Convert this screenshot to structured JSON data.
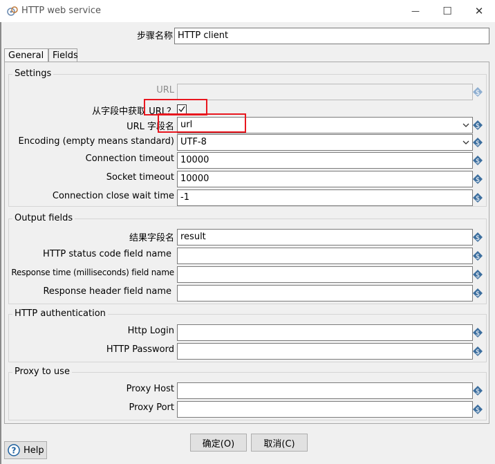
{
  "window": {
    "title": "HTTP web service",
    "minimize_glyph": "—",
    "maximize_glyph": "☐",
    "close_glyph": "✕"
  },
  "step": {
    "label": "步骤名称",
    "value": "HTTP client"
  },
  "tabs": [
    {
      "label": "General",
      "active": true
    },
    {
      "label": "Fields",
      "active": false
    }
  ],
  "settings": {
    "title": "Settings",
    "url": {
      "label": "URL",
      "value": "",
      "enabled": false
    },
    "url_from_field": {
      "label": "从字段中获取 URL？",
      "checked": true
    },
    "url_field_name": {
      "label": "URL 字段名",
      "value": "url"
    },
    "encoding": {
      "label": "Encoding (empty means standard)",
      "value": "UTF-8"
    },
    "connection_timeout": {
      "label": "Connection timeout",
      "value": "10000"
    },
    "socket_timeout": {
      "label": "Socket timeout",
      "value": "10000"
    },
    "close_wait_time": {
      "label": "Connection close wait time",
      "value": "-1"
    }
  },
  "output_fields": {
    "title": "Output fields",
    "result_field": {
      "label": "结果字段名",
      "value": "result"
    },
    "status_code_field": {
      "label": "HTTP status code field name",
      "value": ""
    },
    "response_time_field": {
      "label": "Response time (milliseconds) field name",
      "value": ""
    },
    "response_header_field": {
      "label": "Response header field name",
      "value": ""
    }
  },
  "authentication": {
    "title": "HTTP authentication",
    "login": {
      "label": "Http Login",
      "value": ""
    },
    "password": {
      "label": "HTTP Password",
      "value": ""
    }
  },
  "proxy": {
    "title": "Proxy to use",
    "host": {
      "label": "Proxy Host",
      "value": ""
    },
    "port": {
      "label": "Proxy Port",
      "value": ""
    }
  },
  "buttons": {
    "ok": "确定(O)",
    "cancel": "取消(C)",
    "help": "Help"
  },
  "colors": {
    "highlight_box": "#e8161e",
    "variable_icon": "#3c6e9e"
  },
  "icons": {
    "variable": "dollar-variable-icon",
    "help": "question-circle-icon",
    "app": "web-service-icon",
    "dropdown": "chevron-down-icon"
  }
}
